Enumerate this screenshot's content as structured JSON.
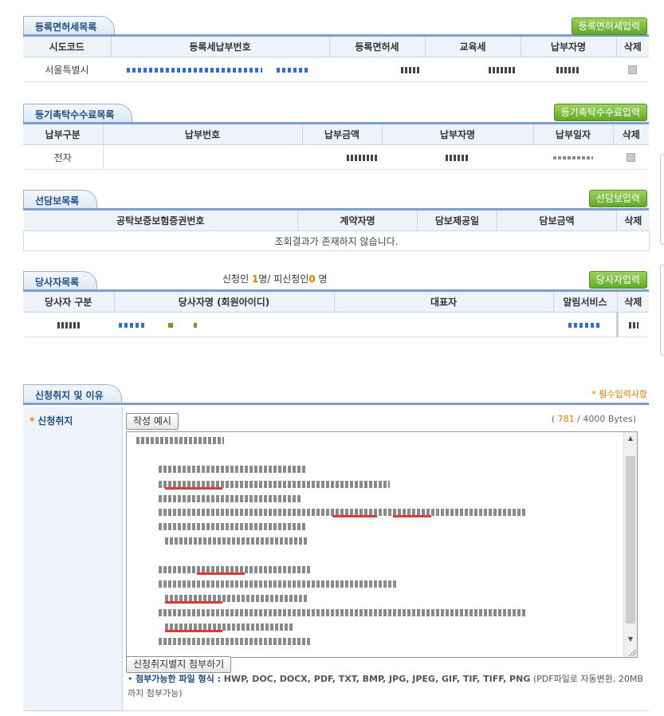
{
  "reg_tax": {
    "title": "등록면허세목록",
    "add_label": "등록면허세입력",
    "headers": [
      "시도코드",
      "등록세납부번호",
      "등록면허세",
      "교육세",
      "납부자명",
      "삭제"
    ],
    "row": {
      "sido": "서울특별시"
    }
  },
  "fee": {
    "title": "등기촉탁수수료목록",
    "add_label": "등기촉탁수수료입력",
    "headers": [
      "납부구분",
      "납부번호",
      "납부금액",
      "납부자명",
      "납부일자",
      "삭제"
    ],
    "row": {
      "type": "전자"
    }
  },
  "collateral": {
    "title": "선담보목록",
    "add_label": "선담보입력",
    "headers": [
      "공탁보증보험증권번호",
      "계약자명",
      "담보제공일",
      "담보금액",
      "삭제"
    ],
    "empty_message": "조회결과가 존재하지 않습니다."
  },
  "party": {
    "title": "당사자목록",
    "add_label": "당사자입력",
    "count_prefix": "신청인 ",
    "applicant_count": "1",
    "count_mid": "명/ 피신청인",
    "respondent_count": "0",
    "count_suffix": " 명",
    "headers": [
      "당사자 구분",
      "당사자명 (회원아이디)",
      "대표자",
      "알림서비스",
      "삭제"
    ]
  },
  "withdrawal": {
    "title": "신청취지 및 이유",
    "required_note": "* 필수입력사항",
    "field_label": "신청취지",
    "required_mark": "*",
    "example_button": "작성 예시",
    "bytes_current": "781",
    "bytes_max": " / 4000 Bytes)",
    "bytes_open": "( ",
    "attach_button": "신청취지별지 첨부하기",
    "formats_label": "첨부가능한 파일 형식 :",
    "formats": " HWP, DOC, DOCX, PDF, TXT, BMP, JPG, JPEG, GIF, TIF, TIFF, PNG",
    "formats_note": " (PDF파일로 자동변환, 20MB까지 첨부가능)"
  },
  "colors": {
    "accent": "#1f4c86",
    "green": "#62a82b",
    "orange": "#e07b00"
  }
}
